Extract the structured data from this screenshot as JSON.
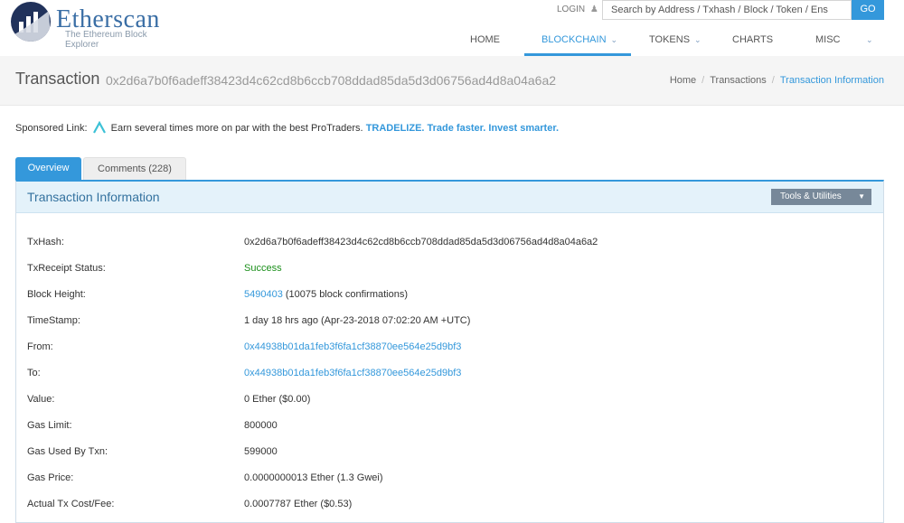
{
  "header": {
    "logo_title": "Etherscan",
    "logo_subtitle": "The Ethereum Block Explorer",
    "login": "LOGIN",
    "search_placeholder": "Search by Address / Txhash / Block / Token / Ens",
    "go": "GO",
    "nav": [
      "HOME",
      "BLOCKCHAIN",
      "TOKENS",
      "CHARTS",
      "MISC"
    ],
    "active_nav": "BLOCKCHAIN"
  },
  "page": {
    "title": "Transaction",
    "tx_hash": "0x2d6a7b0f6adeff38423d4c62cd8b6ccb708ddad85da5d3d06756ad4d8a04a6a2"
  },
  "breadcrumb": [
    "Home",
    "Transactions",
    "Transaction Information"
  ],
  "sponsored": {
    "label": "Sponsored Link:",
    "text": "Earn several times more on par with the best ProTraders.",
    "link": "TRADELIZE. Trade faster. Invest smarter."
  },
  "tabs": [
    "Overview",
    "Comments (228)"
  ],
  "panel": {
    "title": "Transaction Information",
    "tools": "Tools & Utilities"
  },
  "rows": [
    {
      "label": "TxHash:",
      "value": "0x2d6a7b0f6adeff38423d4c62cd8b6ccb708ddad85da5d3d06756ad4d8a04a6a2"
    },
    {
      "label": "TxReceipt Status:",
      "value": "Success"
    },
    {
      "label": "Block Height:",
      "value": "5490403",
      "extra": " (10075 block confirmations)"
    },
    {
      "label": "TimeStamp:",
      "value": "1 day 18 hrs ago (Apr-23-2018 07:02:20 AM +UTC)"
    },
    {
      "label": "From:",
      "value": "0x44938b01da1feb3f6fa1cf38870ee564e25d9bf3"
    },
    {
      "label": "To:",
      "value": "0x44938b01da1feb3f6fa1cf38870ee564e25d9bf3"
    },
    {
      "label": "Value:",
      "value": "0 Ether ($0.00)"
    },
    {
      "label": "Gas Limit:",
      "value": "800000"
    },
    {
      "label": "Gas Used By Txn:",
      "value": "599000"
    },
    {
      "label": "Gas Price:",
      "value": "0.0000000013 Ether (1.3 Gwei)"
    },
    {
      "label": "Actual Tx Cost/Fee:",
      "value": "0.0007787 Ether ($0.53)"
    }
  ],
  "colors": {
    "accent": "#3498db",
    "success": "#1b8f1b",
    "brand": "#21325b"
  }
}
